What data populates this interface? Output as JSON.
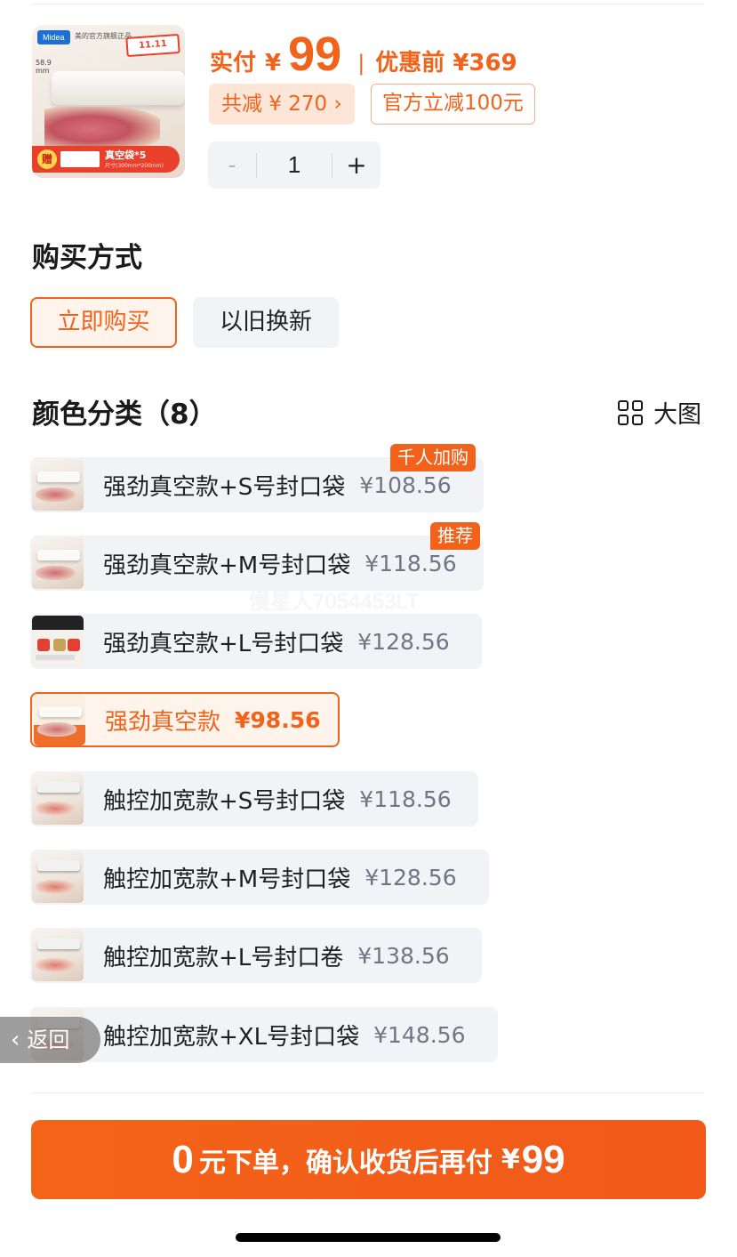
{
  "product": {
    "thumb": {
      "brand": "Midea",
      "brand_sub": "美的官方旗舰正品",
      "promo": "11.11",
      "size_note": "58.9 mm",
      "gift_badge": "赠",
      "gift_text": "真空袋*5",
      "gift_sub": "尺寸(300mm*200mm)"
    },
    "price_label": "实付",
    "currency": "¥",
    "price": "99",
    "separator": "|",
    "price_before": "优惠前 ¥369",
    "discount_chip": "共减 ¥ 270 ›",
    "official_chip": "官方立减100元"
  },
  "stepper": {
    "minus": "-",
    "quantity": "1",
    "plus": "+"
  },
  "purchase": {
    "title": "购买方式",
    "options": [
      "立即购买",
      "以旧换新"
    ]
  },
  "colors": {
    "title": "颜色分类（8）",
    "big_view_label": "大图",
    "variants": [
      {
        "label": "强劲真空款+S号封口袋",
        "price": "¥108.56",
        "tag": "千人加购"
      },
      {
        "label": "强劲真空款+M号封口袋",
        "price": "¥118.56",
        "tag": "推荐"
      },
      {
        "label": "强劲真空款+L号封口袋",
        "price": "¥128.56"
      },
      {
        "label": "强劲真空款",
        "price": "¥98.56",
        "selected": true
      },
      {
        "label": "触控加宽款+S号封口袋",
        "price": "¥118.56"
      },
      {
        "label": "触控加宽款+M号封口袋",
        "price": "¥128.56"
      },
      {
        "label": "触控加宽款+L号封口卷",
        "price": "¥138.56"
      },
      {
        "label": "触控加宽款+XL号封口袋",
        "price": "¥148.56"
      }
    ]
  },
  "watermark": "慢星人7054453LT",
  "back": {
    "label": "返回"
  },
  "submit": {
    "lead": "0",
    "text": "元下单，确认收货后再付",
    "currency": "¥",
    "amount": "99"
  },
  "colors_palette": {
    "accent": "#f2621b",
    "chip_bg": "#f2f3f6",
    "selected_bg": "#fff4ec"
  }
}
